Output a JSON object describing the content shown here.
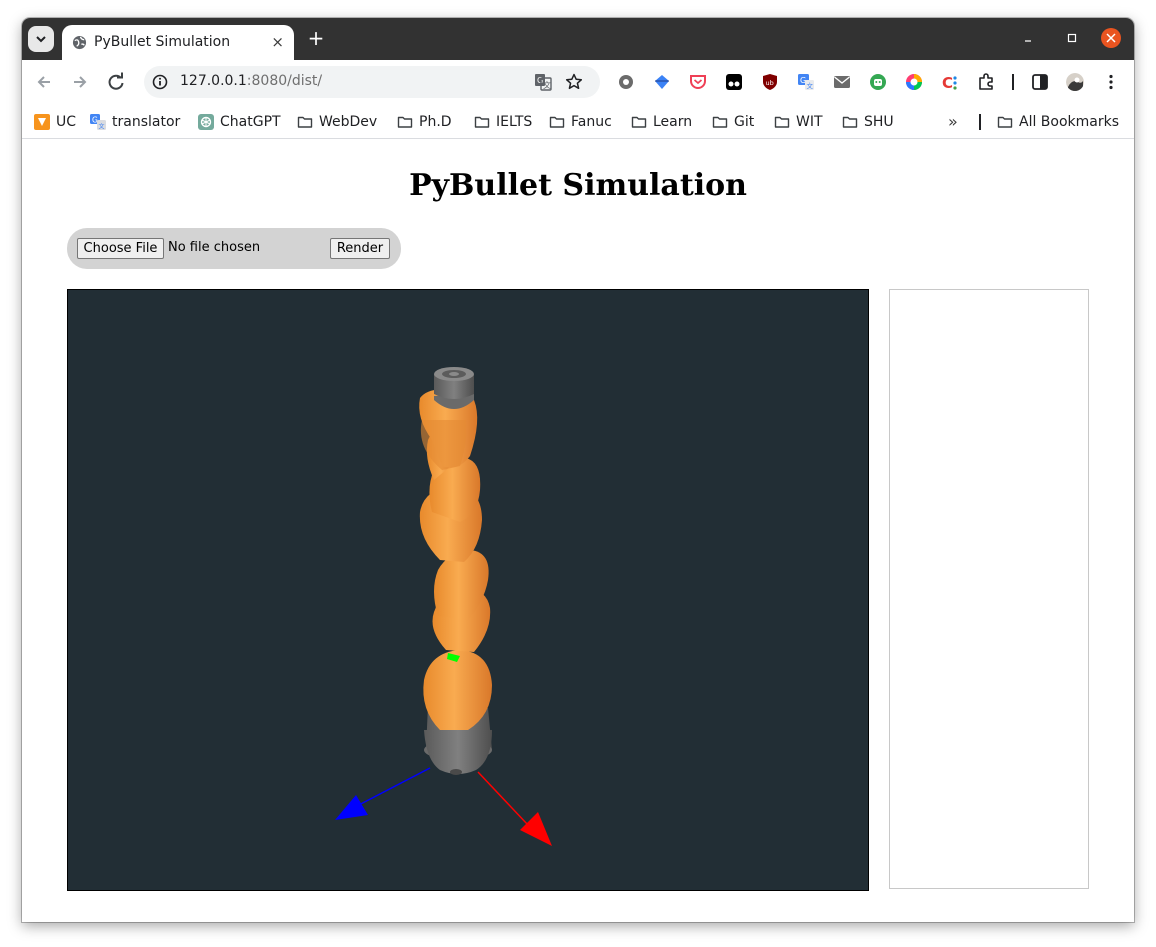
{
  "browser": {
    "tab_title": "PyBullet Simulation",
    "url_host": "127.0.0.1",
    "url_path": ":8080/dist/",
    "new_tab_symbol": "+",
    "close_tab_symbol": "×",
    "chevron_symbol": "»"
  },
  "bookmarks": [
    {
      "label": "UC",
      "icon": "uc-icon"
    },
    {
      "label": "translator",
      "icon": "google-translate-icon"
    },
    {
      "label": "ChatGPT",
      "icon": "chatgpt-icon"
    },
    {
      "label": "WebDev",
      "icon": "folder-icon"
    },
    {
      "label": "Ph.D",
      "icon": "folder-icon"
    },
    {
      "label": "IELTS",
      "icon": "folder-icon"
    },
    {
      "label": "Fanuc",
      "icon": "folder-icon"
    },
    {
      "label": "Learn",
      "icon": "folder-icon"
    },
    {
      "label": "Git",
      "icon": "folder-icon"
    },
    {
      "label": "WIT",
      "icon": "folder-icon"
    },
    {
      "label": "SHU",
      "icon": "folder-icon"
    }
  ],
  "all_bookmarks_label": "All Bookmarks",
  "page": {
    "title": "PyBullet Simulation",
    "choose_file_label": "Choose File",
    "file_status": "No file chosen",
    "render_label": "Render"
  },
  "scene": {
    "background_color": "#222e35",
    "robot_color": "#f5a043",
    "base_color": "#6b6b6b",
    "marker_color": "#00ff00",
    "axis_colors": {
      "x": "#ff0000",
      "z": "#0000ff"
    }
  }
}
